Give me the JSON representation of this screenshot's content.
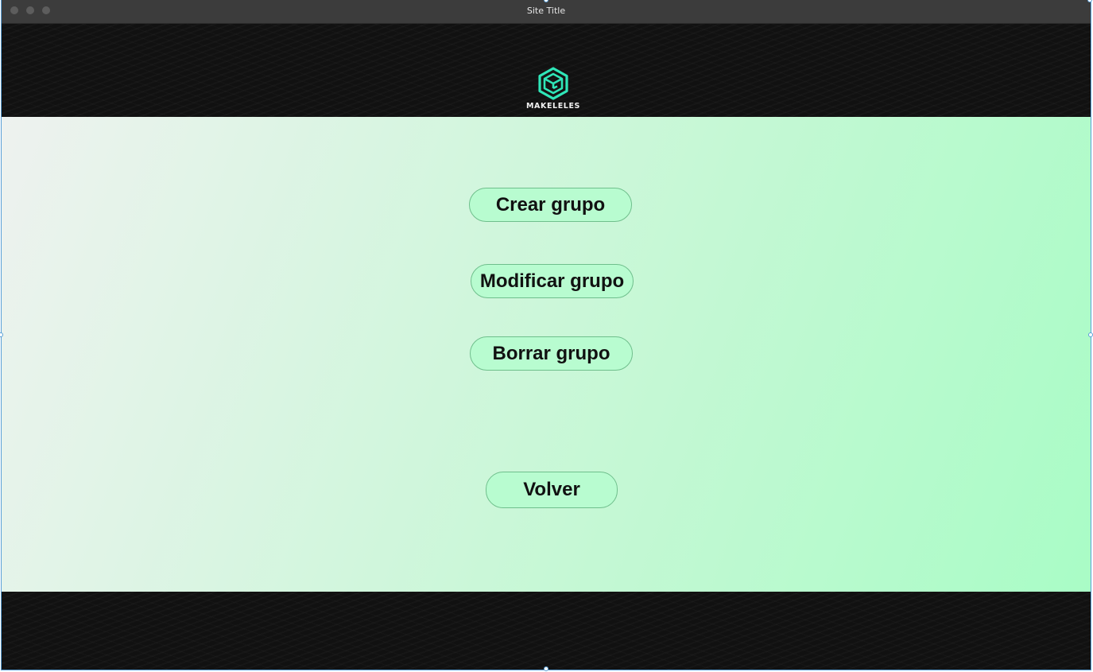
{
  "window": {
    "title": "Site Title"
  },
  "header": {
    "logo_text": "MAKELELES",
    "logo_icon": "cube-logo-icon",
    "logo_color": "#2fe6b8"
  },
  "main": {
    "buttons": {
      "crear": "Crear grupo",
      "modificar": "Modificar grupo",
      "borrar": "Borrar grupo",
      "volver": "Volver"
    },
    "button_color": "#b8fcd0",
    "gradient_start": "#eef2ef",
    "gradient_end": "#a9fcc6"
  },
  "colors": {
    "titlebar": "#3c3c3c",
    "header_footer": "#111111",
    "selection_border": "#5aa0d8"
  }
}
